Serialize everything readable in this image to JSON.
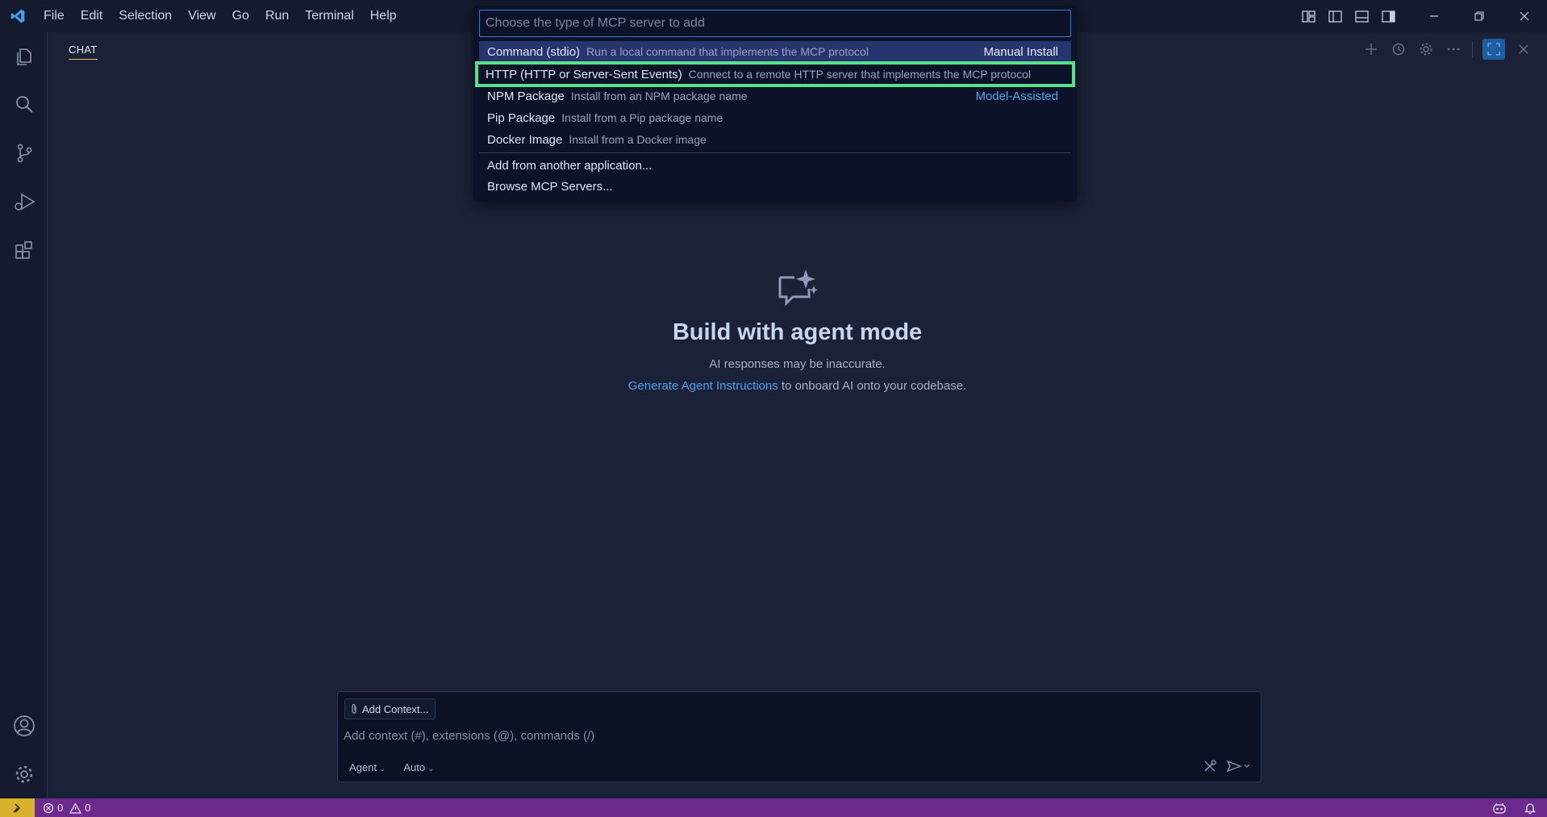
{
  "menu": [
    "File",
    "Edit",
    "Selection",
    "View",
    "Go",
    "Run",
    "Terminal",
    "Help"
  ],
  "chat_tab": "CHAT",
  "quickpick": {
    "placeholder": "Choose the type of MCP server to add",
    "items": [
      {
        "label": "Command (stdio)",
        "desc": "Run a local command that implements the MCP protocol",
        "tag": "Manual Install"
      },
      {
        "label": "HTTP (HTTP or Server-Sent Events)",
        "desc": "Connect to a remote HTTP server that implements the MCP protocol",
        "tag": ""
      },
      {
        "label": "NPM Package",
        "desc": "Install from an NPM package name",
        "tag": "Model-Assisted"
      },
      {
        "label": "Pip Package",
        "desc": "Install from a Pip package name",
        "tag": ""
      },
      {
        "label": "Docker Image",
        "desc": "Install from a Docker image",
        "tag": ""
      },
      {
        "label": "Add from another application...",
        "desc": "",
        "tag": ""
      },
      {
        "label": "Browse MCP Servers...",
        "desc": "",
        "tag": ""
      }
    ]
  },
  "welcome": {
    "title": "Build with agent mode",
    "subtitle": "AI responses may be inaccurate.",
    "link": "Generate Agent Instructions",
    "line_rest": " to onboard AI onto your codebase."
  },
  "chat_input": {
    "add_context": "Add Context...",
    "placeholder": "Add context (#), extensions (@), commands (/)",
    "mode": "Agent",
    "model": "Auto"
  },
  "status": {
    "errors": "0",
    "warnings": "0"
  },
  "colors": {
    "accent": "#4ea3f0",
    "statusbar": "#6c2a8c",
    "remote": "#d9b22c",
    "highlight": "#57e38b"
  }
}
